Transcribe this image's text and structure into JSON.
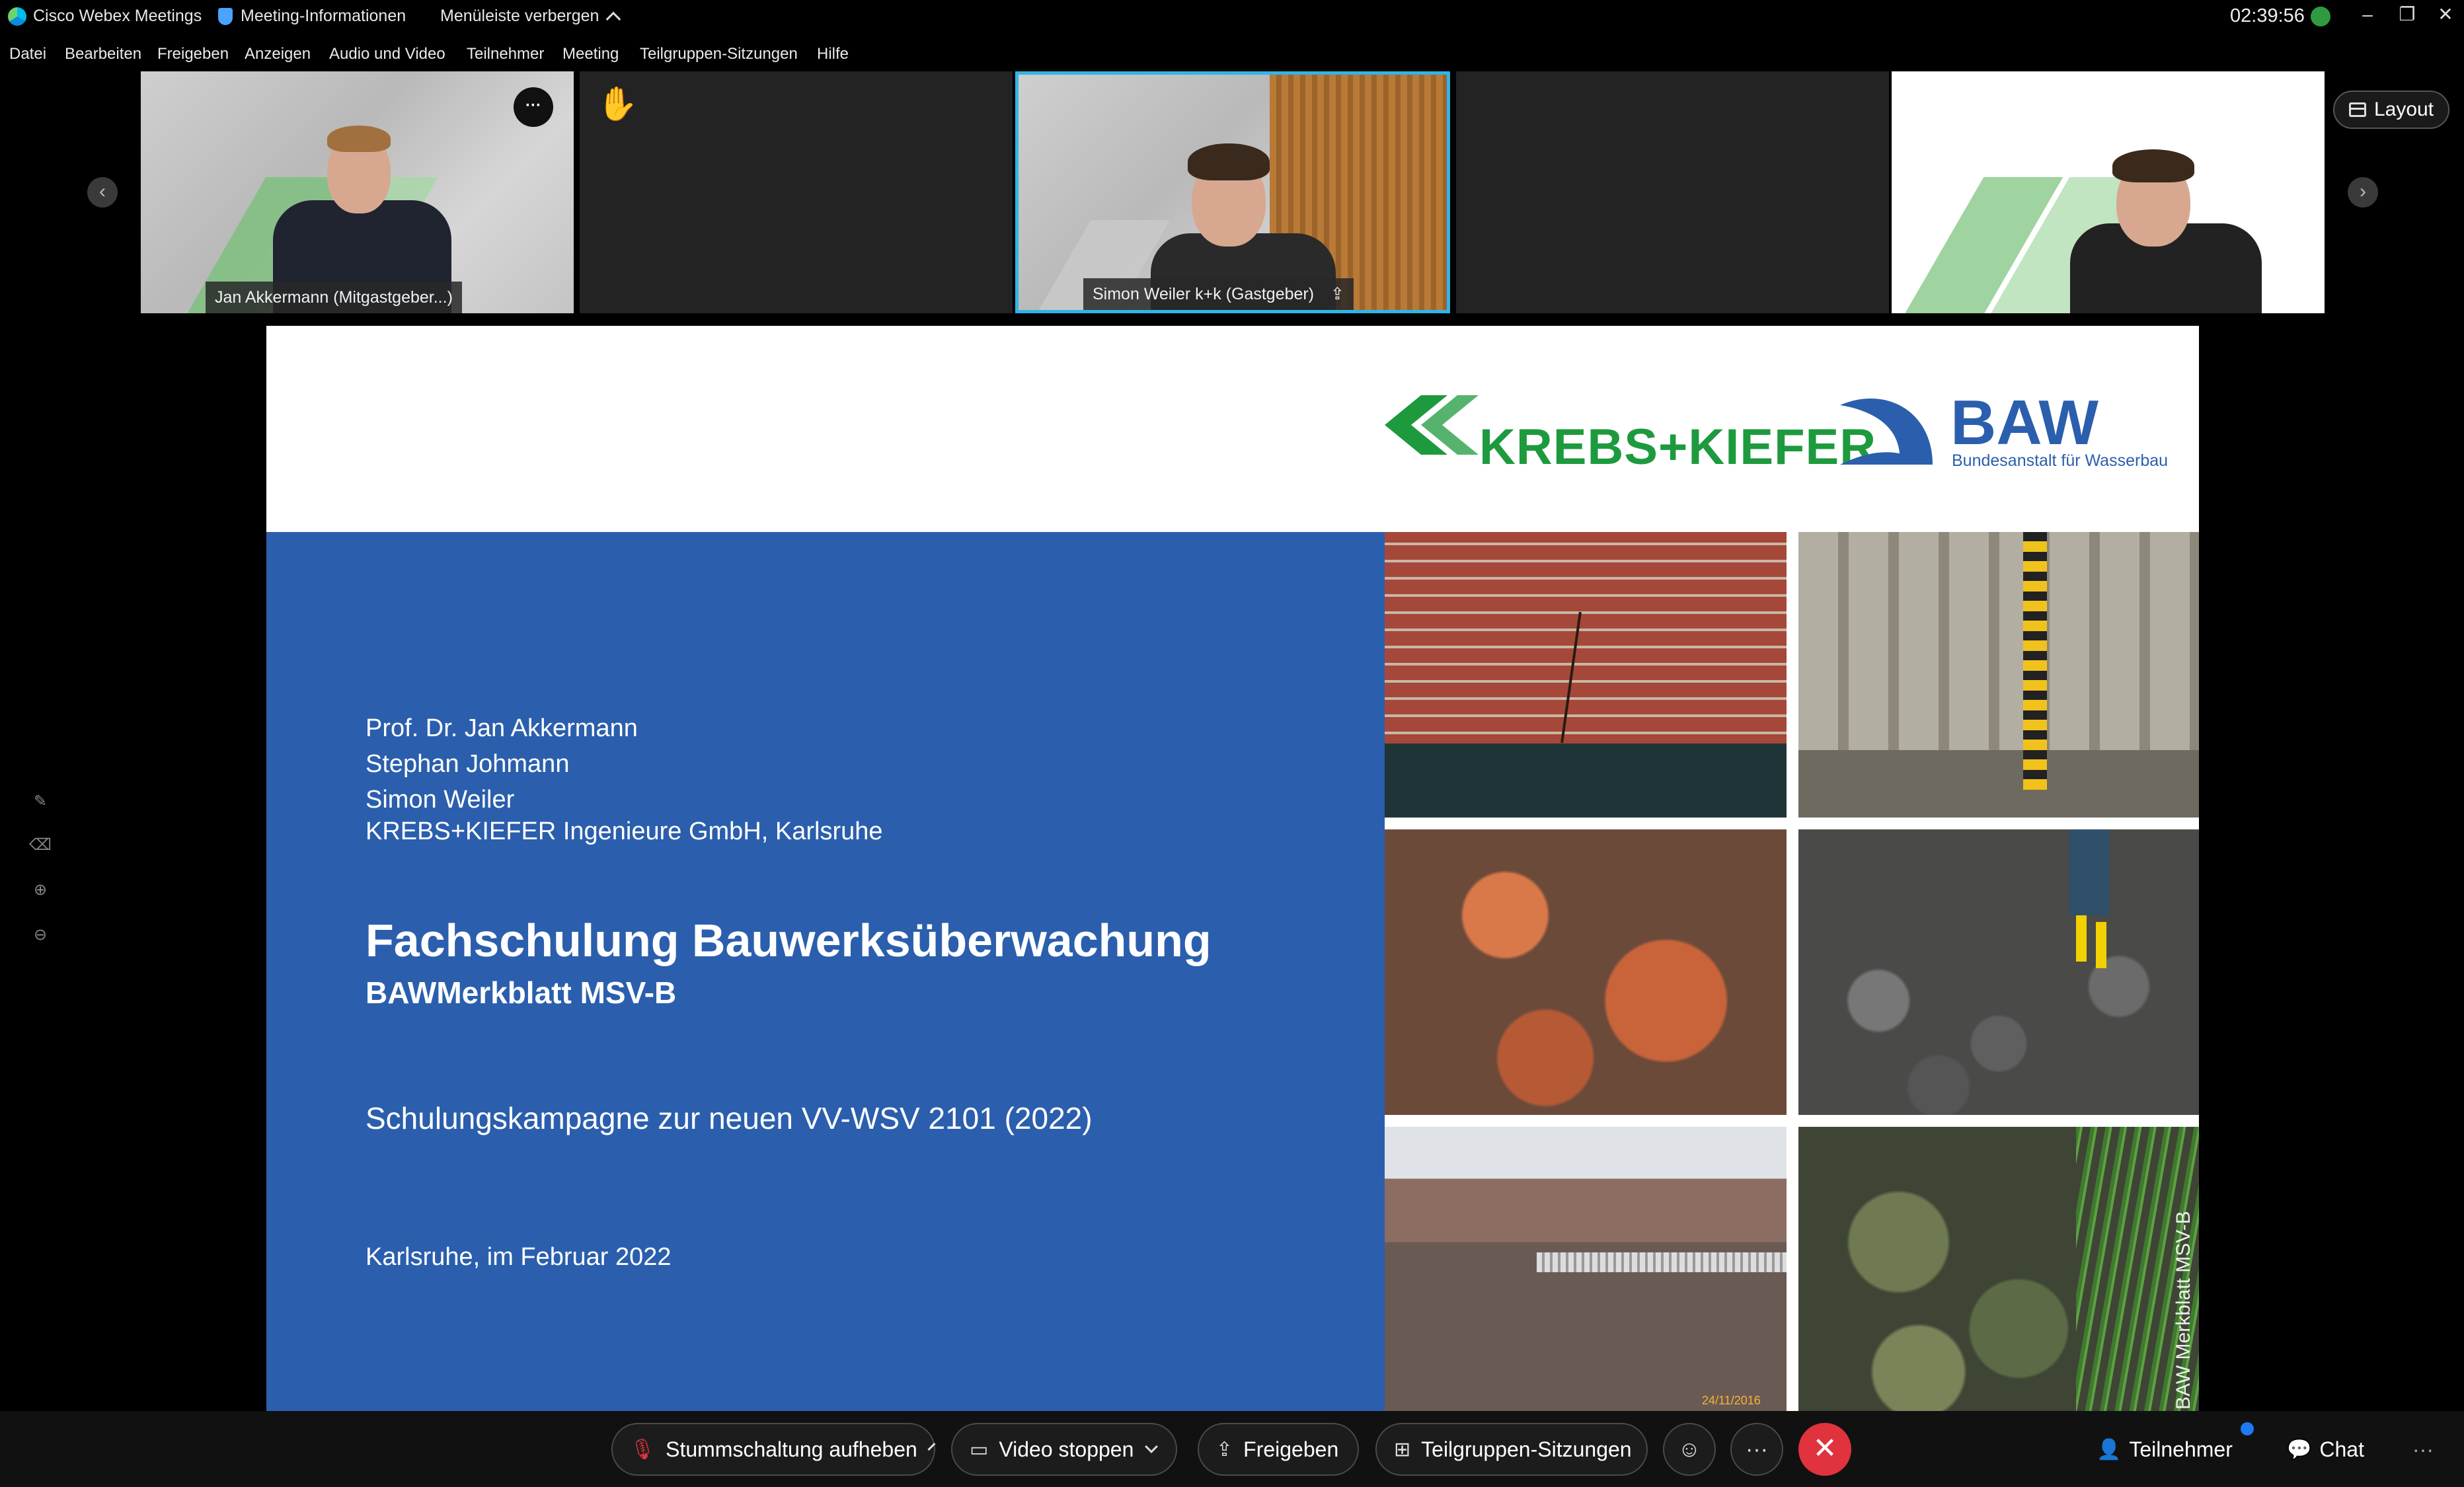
{
  "titlebar": {
    "app_name": "Cisco Webex Meetings",
    "meeting_info": "Meeting-Informationen",
    "hide_menu": "Menüleiste verbergen",
    "clock": "02:39:56"
  },
  "menu": [
    "Datei",
    "Bearbeiten",
    "Freigeben",
    "Anzeigen",
    "Audio und Video",
    "Teilnehmer",
    "Meeting",
    "Teilgruppen-Sitzungen",
    "Hilfe"
  ],
  "participants": [
    {
      "name": "Jan Akkermann  (Mitgastgeber...)"
    },
    {
      "name": "Simon Weiler k+k  (Gastgeber)"
    }
  ],
  "layout_label": "Layout",
  "slide": {
    "logo_krebs": "KREBS+KIEFER",
    "logo_baw": "BAW",
    "logo_baw_sub": "Bundesanstalt für Wasserbau",
    "authors": [
      "Prof. Dr. Jan Akkermann",
      "Stephan Johmann",
      "Simon Weiler"
    ],
    "company": "KREBS+KIEFER Ingenieure GmbH, Karlsruhe",
    "title": "Fachschulung Bauwerksüberwachung",
    "subtitle": "BAWMerkblatt MSV-B",
    "campaign": "Schulungskampagne zur neuen VV-WSV 2101 (2022)",
    "place_date": "Karlsruhe, im Februar 2022",
    "vertical_label": "BAW Merkblatt MSV-B",
    "photo_date": "24/11/2016"
  },
  "toolbar": {
    "unmute": "Stummschaltung aufheben",
    "video": "Video stoppen",
    "share": "Freigeben",
    "breakout": "Teilgruppen-Sitzungen",
    "participants": "Teilnehmer",
    "chat": "Chat"
  },
  "icons": {
    "more": "···",
    "end_call": "✕"
  },
  "colors": {
    "accent": "#2fb5e8",
    "slide_blue": "#2b5fad",
    "krebs_green": "#1e9a3e",
    "end_call_red": "#e0333d"
  }
}
